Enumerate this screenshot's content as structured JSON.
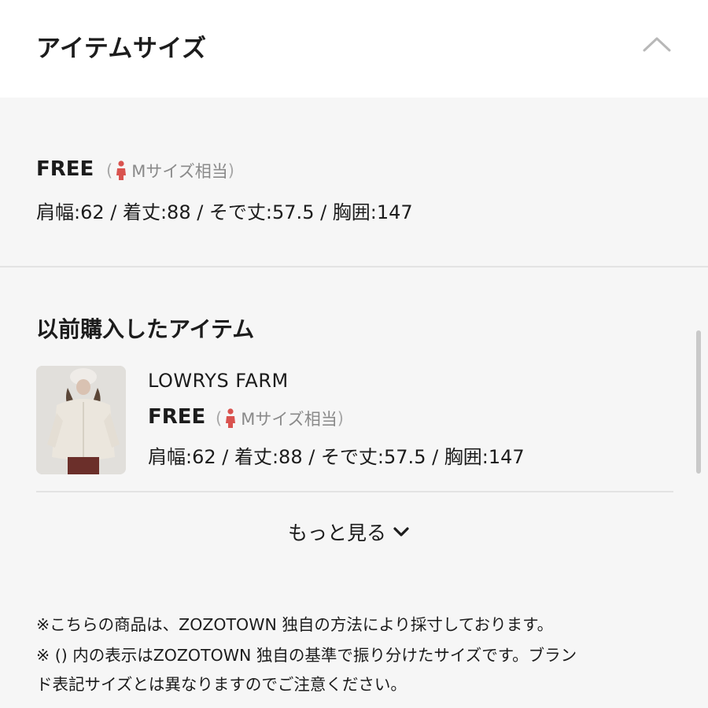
{
  "header": {
    "title": "アイテムサイズ"
  },
  "current_size": {
    "size": "FREE",
    "equiv_open": "(",
    "equiv_text": "Mサイズ相当",
    "equiv_close": ")",
    "measurements": "肩幅:62 / 着丈:88 / そで丈:57.5 / 胸囲:147"
  },
  "previous": {
    "title": "以前購入したアイテム",
    "items": [
      {
        "brand": "LOWRYS FARM",
        "size": "FREE",
        "equiv_open": "(",
        "equiv_text": "Mサイズ相当",
        "equiv_close": ")",
        "measurements": "肩幅:62 / 着丈:88 / そで丈:57.5 / 胸囲:147"
      }
    ],
    "more_label": "もっと見る"
  },
  "notes": [
    "※こちらの商品は、ZOZOTOWN 独自の方法により採寸しております。",
    "※ () 内の表示はZOZOTOWN 独自の基準で振り分けたサイズです。ブラン",
    "ド表記サイズとは異なりますのでご注意ください。"
  ],
  "colors": {
    "accent_icon": "#d9534f",
    "muted": "#8a8a8a",
    "divider": "#e3e3e3"
  },
  "icons": {
    "collapse": "chevron-up-icon",
    "expand": "chevron-down-icon",
    "size_person": "person-icon"
  }
}
